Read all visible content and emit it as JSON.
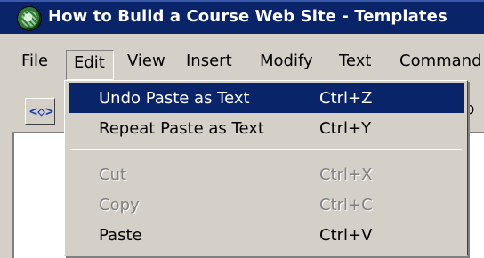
{
  "window": {
    "title": "How to Build a Course Web Site - Templates"
  },
  "menubar": {
    "items": [
      "File",
      "Edit",
      "View",
      "Insert",
      "Modify",
      "Text",
      "Command"
    ]
  },
  "toolbar": {
    "code_icon_glyph": "<◇>",
    "tail_text": "b"
  },
  "edit_menu": {
    "items": [
      {
        "label": "Undo Paste as Text",
        "shortcut": "Ctrl+Z",
        "state": "highlighted"
      },
      {
        "label": "Repeat Paste as Text",
        "shortcut": "Ctrl+Y",
        "state": "enabled"
      },
      {
        "label": "Cut",
        "shortcut": "Ctrl+X",
        "state": "disabled"
      },
      {
        "label": "Copy",
        "shortcut": "Ctrl+C",
        "state": "disabled"
      },
      {
        "label": "Paste",
        "shortcut": "Ctrl+V",
        "state": "enabled"
      }
    ]
  },
  "colors": {
    "titlebar": "#0a246a",
    "highlight": "#0a246a",
    "chrome": "#d4d0c8",
    "disabled_text": "#808080"
  }
}
